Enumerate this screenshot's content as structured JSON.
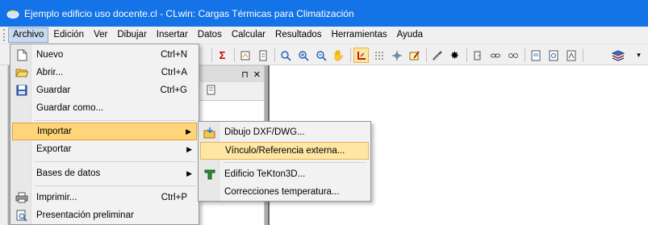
{
  "window": {
    "title": "Ejemplo edificio uso docente.cl - CLwin: Cargas Térmicas para Climatización"
  },
  "menubar": {
    "items": [
      {
        "label": "Archivo"
      },
      {
        "label": "Edición"
      },
      {
        "label": "Ver"
      },
      {
        "label": "Dibujar"
      },
      {
        "label": "Insertar"
      },
      {
        "label": "Datos"
      },
      {
        "label": "Calcular"
      },
      {
        "label": "Resultados"
      },
      {
        "label": "Herramientas"
      },
      {
        "label": "Ayuda"
      }
    ],
    "active": "Archivo"
  },
  "file_menu": {
    "items": [
      {
        "label": "Nuevo",
        "shortcut": "Ctrl+N",
        "icon": "new-document-icon"
      },
      {
        "label": "Abrir...",
        "shortcut": "Ctrl+A",
        "icon": "open-folder-icon"
      },
      {
        "label": "Guardar",
        "shortcut": "Ctrl+G",
        "icon": "save-disk-icon"
      },
      {
        "label": "Guardar como...",
        "shortcut": "",
        "icon": ""
      },
      {
        "label": "Importar",
        "shortcut": "",
        "icon": "",
        "submenu": true
      },
      {
        "label": "Exportar",
        "shortcut": "",
        "icon": "",
        "submenu": true
      },
      {
        "label": "Bases de datos",
        "shortcut": "",
        "icon": "",
        "submenu": true
      },
      {
        "label": "Imprimir...",
        "shortcut": "Ctrl+P",
        "icon": "printer-icon"
      },
      {
        "label": "Presentación preliminar",
        "shortcut": "",
        "icon": "print-preview-icon"
      }
    ]
  },
  "import_submenu": {
    "items": [
      {
        "label": "Dibujo DXF/DWG...",
        "icon": "dxf-import-icon"
      },
      {
        "label": "Vínculo/Referencia externa...",
        "icon": ""
      },
      {
        "label": "Edificio TeKton3D...",
        "icon": "tekton3d-icon"
      },
      {
        "label": "Correcciones temperatura...",
        "icon": ""
      }
    ]
  },
  "panel": {
    "pin_glyph": "⊓",
    "close_glyph": "✕"
  },
  "colors": {
    "titlebar": "#1473e6",
    "menu_highlight": "#fed57a",
    "submenu_highlight": "#fee6a4",
    "workspace": "#ababab"
  }
}
